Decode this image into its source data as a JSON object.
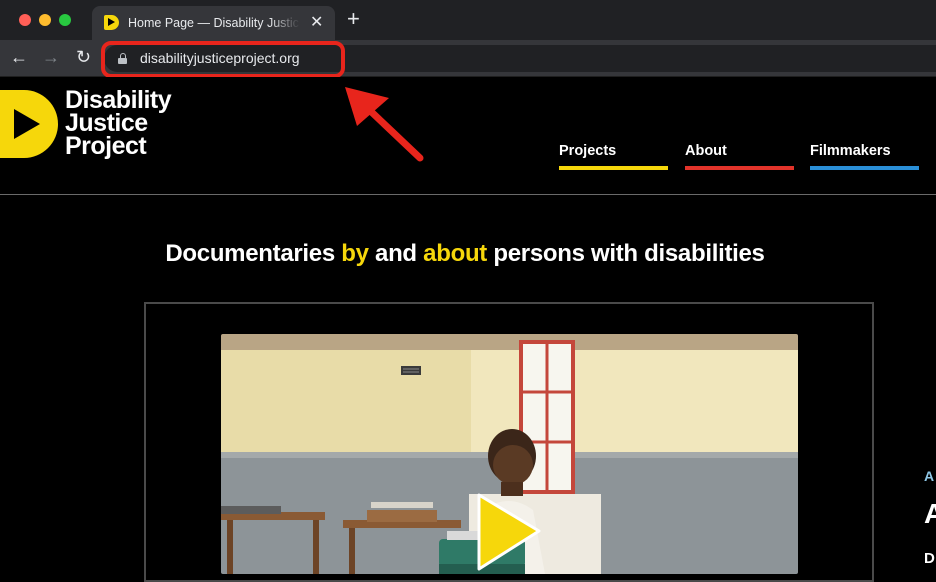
{
  "browser": {
    "tab": {
      "title": "Home Page — Disability Justice Project",
      "close_glyph": "✕"
    },
    "new_tab_glyph": "+",
    "nav": {
      "back_glyph": "←",
      "forward_glyph": "→",
      "reload_glyph": "↻"
    },
    "address_bar": {
      "url": "disabilityjusticeproject.org"
    },
    "annotation": {
      "highlight_color": "#e8251c"
    }
  },
  "site": {
    "logo": {
      "lines": [
        "Disability",
        "Justice",
        "Project"
      ],
      "mark_color": "#f6d70b"
    },
    "nav": [
      {
        "label": "Projects",
        "underline_color": "#f6d70b"
      },
      {
        "label": "About",
        "underline_color": "#e2332a"
      },
      {
        "label": "Filmmakers",
        "underline_color": "#2a8fd8"
      }
    ],
    "tagline": {
      "part1": "Documentaries ",
      "highlight1": "by",
      "part2": " and ",
      "highlight2": "about",
      "part3": " persons with disabilities",
      "highlight_color": "#f6d70b"
    },
    "video": {
      "play_color": "#f6d70b"
    },
    "side_peek": {
      "line1": "A",
      "line2": "A",
      "line3": "D"
    }
  }
}
